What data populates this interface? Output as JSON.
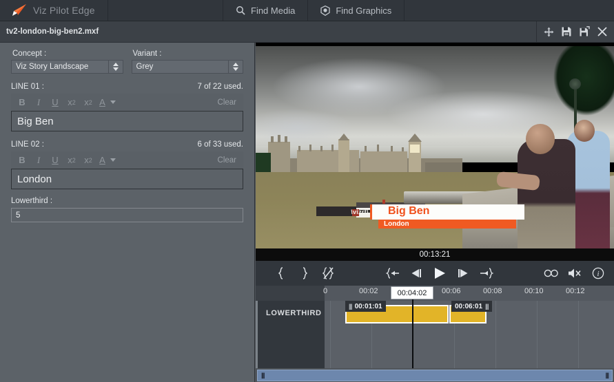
{
  "app": {
    "brand": "Viz Pilot Edge",
    "logo_icon": "orange-arrow-logo"
  },
  "topbar": {
    "buttons": [
      {
        "label": "Find Media",
        "icon": "search-icon"
      },
      {
        "label": "Find Graphics",
        "icon": "graphics-hexagon-icon"
      }
    ]
  },
  "docbar": {
    "filename": "tv2-london-big-ben2.mxf",
    "icons": [
      {
        "name": "move-icon",
        "glyph": "move"
      },
      {
        "name": "save-icon",
        "glyph": "save"
      },
      {
        "name": "save-as-icon",
        "glyph": "save-as"
      },
      {
        "name": "close-icon",
        "glyph": "close"
      }
    ]
  },
  "form": {
    "concept": {
      "label": "Concept :",
      "value": "Viz Story Landscape"
    },
    "variant": {
      "label": "Variant :",
      "value": "Grey"
    },
    "line01": {
      "label": "LINE 01 :",
      "counter": "7 of 22 used.",
      "value": "Big Ben",
      "clear_label": "Clear"
    },
    "line02": {
      "label": "LINE 02 :",
      "counter": "6 of 33 used.",
      "value": "London",
      "clear_label": "Clear"
    },
    "lowerthird": {
      "label": "Lowerthird :",
      "value": "5"
    },
    "format_buttons": [
      {
        "name": "bold-button",
        "label": "B"
      },
      {
        "name": "italic-button",
        "label": "I"
      },
      {
        "name": "underline-button",
        "label": "U"
      },
      {
        "name": "subscript-button",
        "label": "x"
      },
      {
        "name": "superscript-button",
        "label": "x"
      },
      {
        "name": "text-color-button",
        "label": "A"
      }
    ]
  },
  "player": {
    "timecode": "00:13:21",
    "overlay": {
      "logo": "vizrt",
      "line1": "Big Ben",
      "line2": "London",
      "accent_color": "#f0511c",
      "bar_color": "#ffffff"
    },
    "transport": [
      {
        "name": "mark-in-button",
        "glyph": "mark-in"
      },
      {
        "name": "mark-out-button",
        "glyph": "mark-out"
      },
      {
        "name": "clear-marks-button",
        "glyph": "clear-marks"
      },
      {
        "name": "go-to-start-button",
        "glyph": "go-to-start"
      },
      {
        "name": "step-back-button",
        "glyph": "step-back"
      },
      {
        "name": "play-button",
        "glyph": "play"
      },
      {
        "name": "step-forward-button",
        "glyph": "step-forward"
      },
      {
        "name": "go-to-end-button",
        "glyph": "go-to-end"
      },
      {
        "name": "loop-button",
        "glyph": "loop"
      },
      {
        "name": "mute-button",
        "glyph": "mute"
      },
      {
        "name": "info-button",
        "glyph": "info"
      }
    ]
  },
  "timeline": {
    "ruler_ticks": [
      "0",
      "00:02",
      "00:04:02",
      "00:06",
      "00:08",
      "00:10",
      "00:12"
    ],
    "playhead_label": "00:04:02",
    "track": {
      "name": "LOWERTHIRD",
      "clip_in_marker": "00:01:01",
      "clip_out_marker": "00:06:01",
      "clip_color": "#e2b428"
    },
    "scrollbar": {
      "left_grip": "|||",
      "right_grip": "|||"
    }
  },
  "colors": {
    "accent_orange": "#f0511c",
    "panel_bg": "#5c6268",
    "chrome_bg": "#31363c",
    "clip_yellow": "#e2b428",
    "scroll_blue": "#6d87ad"
  }
}
